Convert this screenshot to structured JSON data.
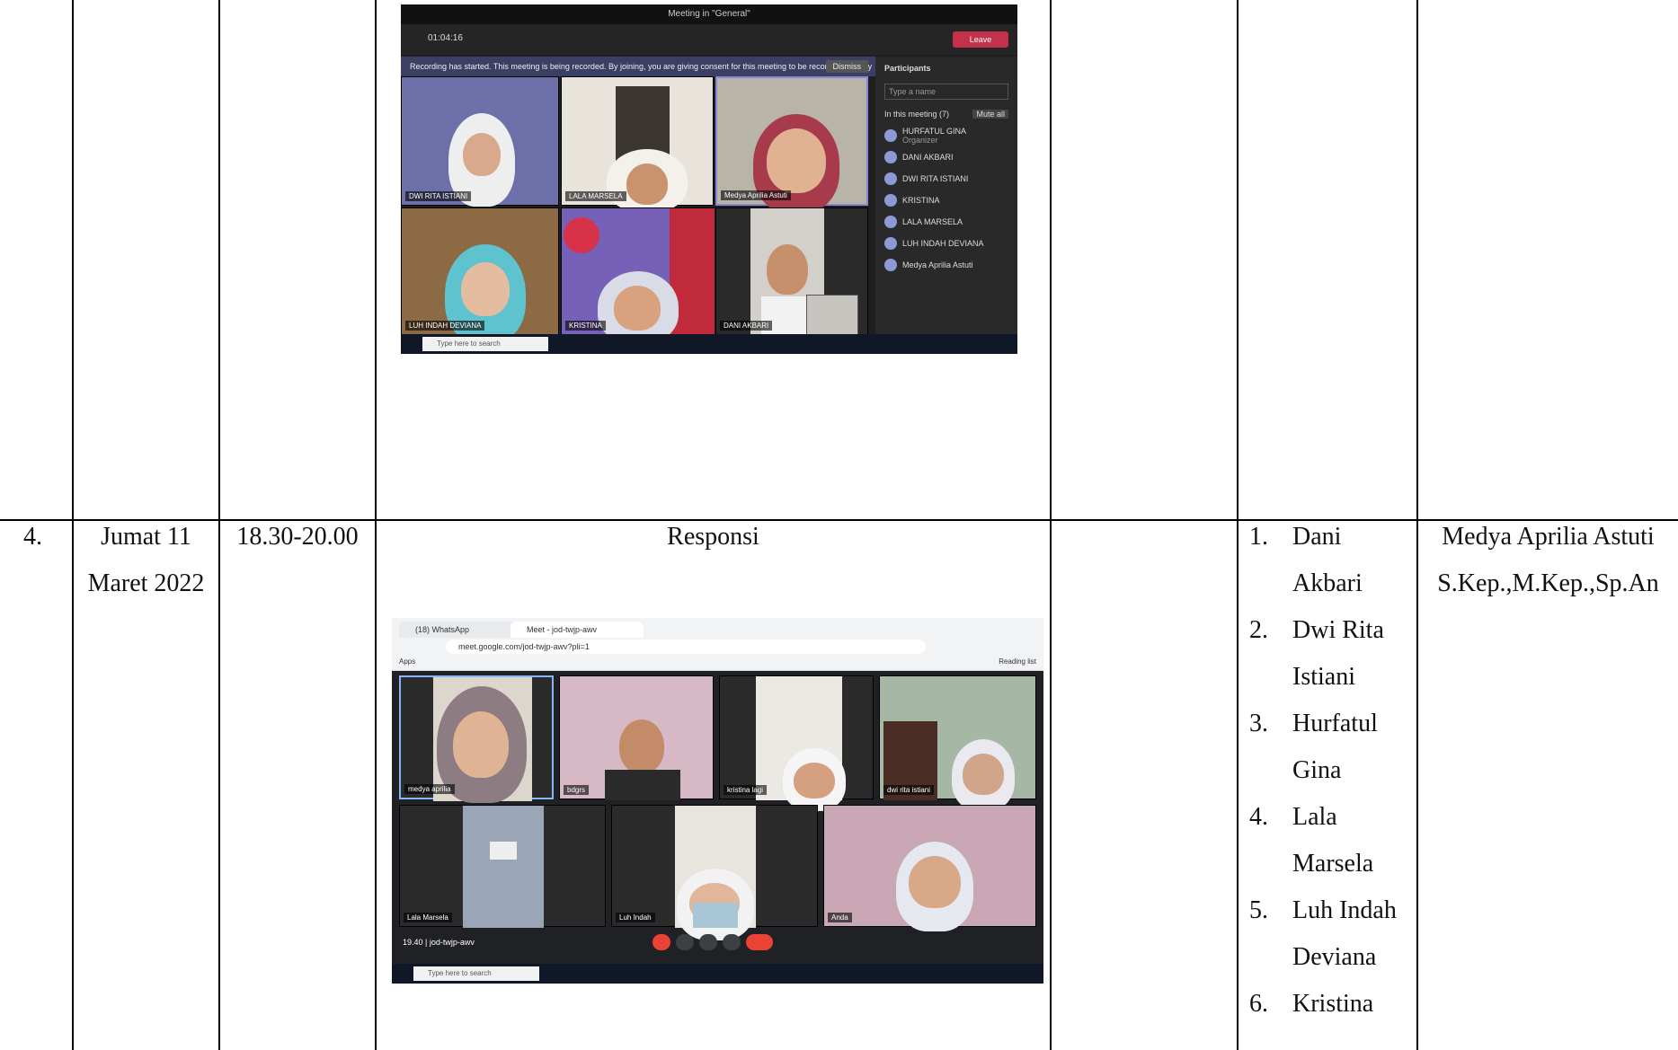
{
  "row_prev": {},
  "row4": {
    "number": "4.",
    "day": "Jumat 11",
    "date": "Maret 2022",
    "time": "18.30-20.00",
    "activity": "Responsi",
    "participants": [
      {
        "num": "1.",
        "name_l1": "Dani",
        "name_l2": "Akbari"
      },
      {
        "num": "2.",
        "name_l1": "Dwi Rita",
        "name_l2": "Istiani"
      },
      {
        "num": "3.",
        "name_l1": "Hurfatul",
        "name_l2": "Gina"
      },
      {
        "num": "4.",
        "name_l1": "Lala",
        "name_l2": "Marsela"
      },
      {
        "num": "5.",
        "name_l1": "Luh Indah",
        "name_l2": "Deviana"
      },
      {
        "num": "6.",
        "name_l1": "Kristina",
        "name_l2": ""
      }
    ],
    "supervisor_l1": "Medya Aprilia Astuti",
    "supervisor_l2": "S.Kep.,M.Kep.,Sp.An"
  },
  "teams_shot": {
    "window_title": "Meeting in \"General\"",
    "timer": "01:04:16",
    "leave_label": "Leave",
    "banner": "Recording has started. This meeting is being recorded. By joining, you are giving consent for this meeting to be recorded. Privacy policy",
    "dismiss": "Dismiss",
    "panel_title": "Participants",
    "search_placeholder": "Type a name",
    "in_meeting": "In this meeting (7)",
    "mute_all": "Mute all",
    "tiles": [
      "DWI RITA ISTIANI",
      "LALA MARSELA",
      "Medya Aprilia Astuti",
      "LUH INDAH DEVIANA",
      "KRISTINA",
      "DANI AKBARI"
    ],
    "participants": [
      "HURFATUL GINA",
      "DANI AKBARI",
      "DWI RITA ISTIANI",
      "KRISTINA",
      "LALA MARSELA",
      "LUH INDAH DEVIANA",
      "Medya Aprilia Astuti"
    ],
    "organizer": "Organizer",
    "taskbar_search": "Type here to search"
  },
  "meet_shot": {
    "tab1": "(18) WhatsApp",
    "tab2": "Meet - jod-twjp-awv",
    "url": "meet.google.com/jod-twjp-awv?pli=1",
    "apps": "Apps",
    "reading_list": "Reading list",
    "tiles": [
      "medya aprilia",
      "bdgrs",
      "kristina lagi",
      "dwi rita istiani",
      "Lala Marsela",
      "Luh Indah",
      "Anda"
    ],
    "meeting_code": "19.40 | jod-twjp-awv",
    "taskbar_search": "Type here to search"
  }
}
